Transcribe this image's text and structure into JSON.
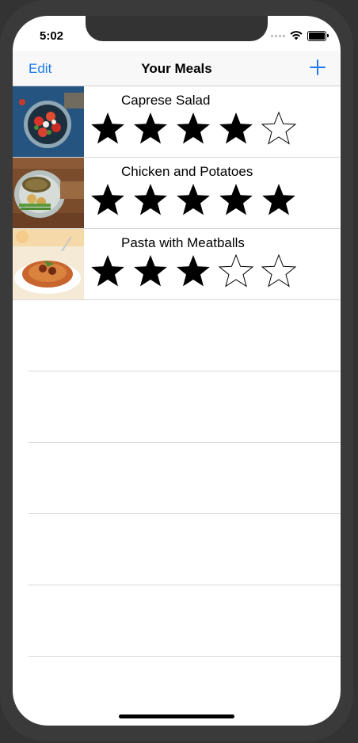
{
  "status_bar": {
    "time": "5:02"
  },
  "nav": {
    "edit_label": "Edit",
    "title": "Your Meals",
    "add_icon": "plus-icon"
  },
  "meals": [
    {
      "name": "Caprese Salad",
      "rating": 4,
      "max_rating": 5,
      "photo": "caprese-salad-photo"
    },
    {
      "name": "Chicken and Potatoes",
      "rating": 5,
      "max_rating": 5,
      "photo": "chicken-potatoes-photo"
    },
    {
      "name": "Pasta with Meatballs",
      "rating": 3,
      "max_rating": 5,
      "photo": "pasta-meatballs-photo"
    }
  ],
  "colors": {
    "accent": "#1e7cf0",
    "star_filled": "#000000",
    "separator": "#d8d8d8"
  }
}
